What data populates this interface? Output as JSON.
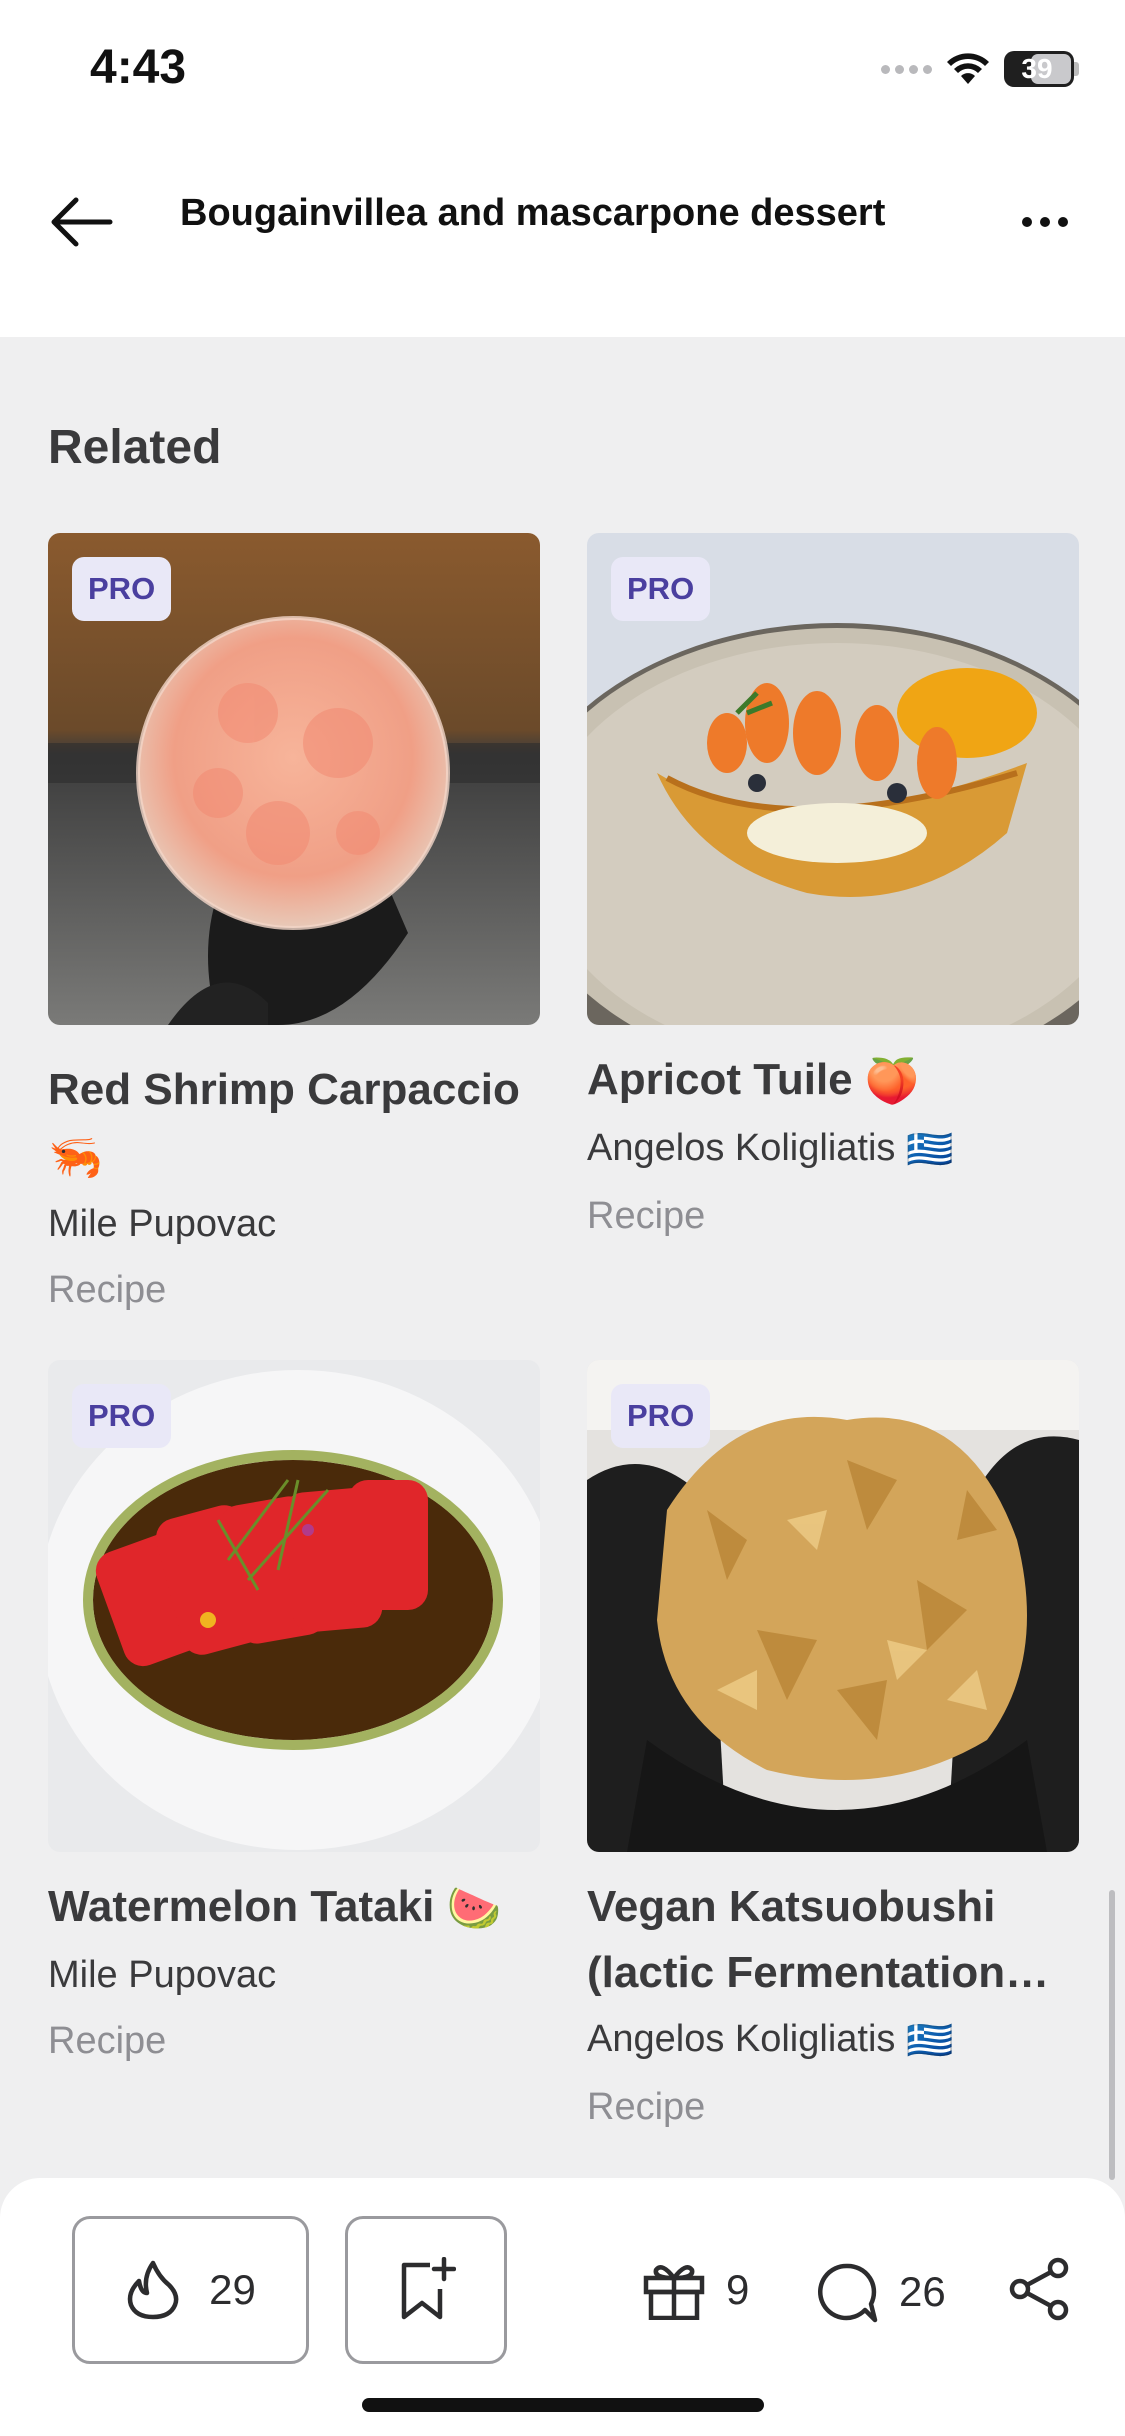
{
  "status_bar": {
    "time": "4:43",
    "battery": "39"
  },
  "header": {
    "title": "Bougainvillea and mascarpone dessert"
  },
  "related": {
    "title": "Related",
    "cards": [
      {
        "badge": "PRO",
        "title": "Red Shrimp Carpaccio",
        "emoji": "🦐",
        "author": "Mile Pupovac",
        "flag": "",
        "type": "Recipe"
      },
      {
        "badge": "PRO",
        "title": "Apricot Tuile",
        "emoji": "🍑",
        "author": "Angelos Koligliatis",
        "flag": "🇬🇷",
        "type": "Recipe"
      },
      {
        "badge": "PRO",
        "title": "Watermelon Tataki",
        "emoji": "🍉",
        "author": "Mile Pupovac",
        "flag": "",
        "type": "Recipe"
      },
      {
        "badge": "PRO",
        "title_line1": "Vegan Katsuobushi",
        "title_line2": "(lactic Fermentation…",
        "author": "Angelos Koligliatis",
        "flag": "🇬🇷",
        "type": "Recipe"
      }
    ]
  },
  "bottom_bar": {
    "fire_count": "29",
    "gift_count": "9",
    "comment_count": "26"
  },
  "colors": {
    "accent_badge_bg": "#e9e8f7",
    "accent_badge_text": "#4a3f9f",
    "background": "#efeff0"
  }
}
